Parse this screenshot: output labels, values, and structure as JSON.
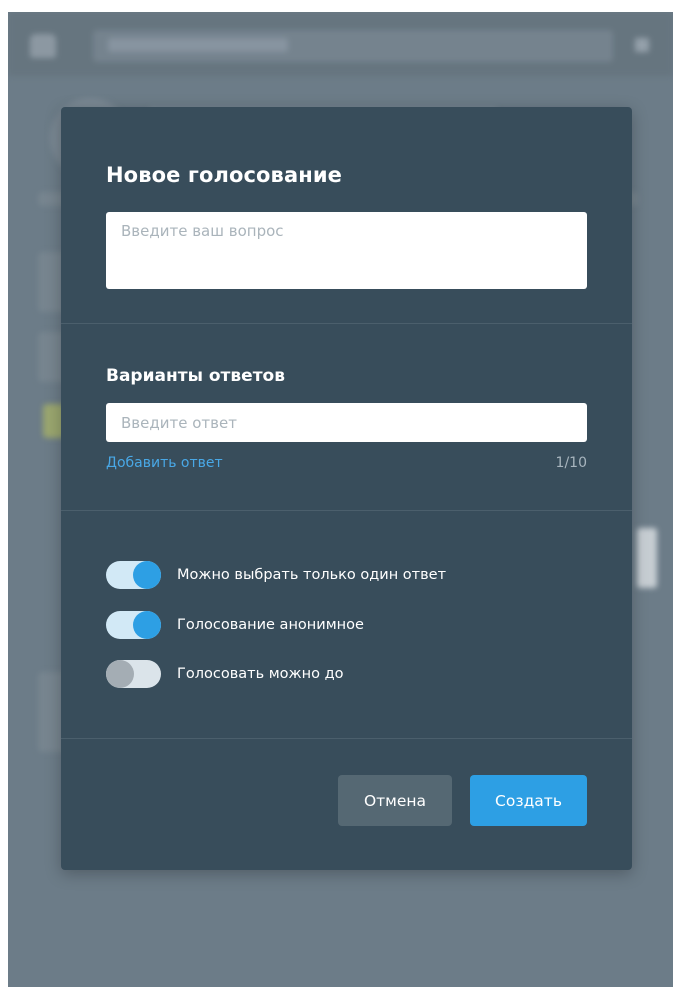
{
  "dialog": {
    "title": "Новое голосование",
    "question_placeholder": "Введите ваш вопрос",
    "answers_section_title": "Варианты ответов",
    "answer_placeholder": "Введите ответ",
    "add_answer_label": "Добавить ответ",
    "answer_count": "1/10",
    "options": [
      {
        "label": "Можно выбрать только один ответ",
        "enabled": true
      },
      {
        "label": "Голосование анонимное",
        "enabled": true
      },
      {
        "label": "Голосовать можно до",
        "enabled": false
      }
    ],
    "cancel_label": "Отмена",
    "create_label": "Создать"
  },
  "colors": {
    "modal_background": "#384d5b",
    "accent": "#2d9fe4",
    "link": "#49a8e6",
    "cancel_button": "#556873",
    "overlay": "#6c7c88"
  },
  "icons": {
    "background_home": "home-icon",
    "background_close": "close-icon"
  }
}
